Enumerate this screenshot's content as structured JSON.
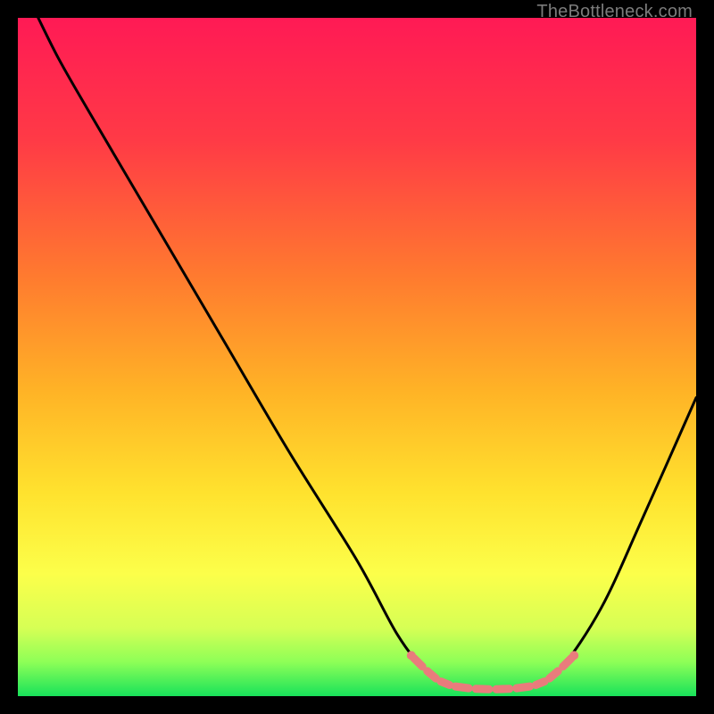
{
  "watermark": "TheBottleneck.com",
  "chart_data": {
    "type": "line",
    "title": "",
    "xlabel": "",
    "ylabel": "",
    "xlim": [
      0,
      100
    ],
    "ylim": [
      0,
      100
    ],
    "gradient_stops": [
      {
        "offset": 0,
        "color": "#ff1a55"
      },
      {
        "offset": 18,
        "color": "#ff3a46"
      },
      {
        "offset": 38,
        "color": "#ff7a2f"
      },
      {
        "offset": 55,
        "color": "#ffb326"
      },
      {
        "offset": 70,
        "color": "#ffe22e"
      },
      {
        "offset": 82,
        "color": "#fcff4a"
      },
      {
        "offset": 90,
        "color": "#d6ff55"
      },
      {
        "offset": 95,
        "color": "#8dff57"
      },
      {
        "offset": 100,
        "color": "#18e25a"
      }
    ],
    "series": [
      {
        "name": "bottleneck-curve",
        "color": "#000000",
        "points": [
          {
            "x": 3,
            "y": 100
          },
          {
            "x": 6,
            "y": 94
          },
          {
            "x": 10,
            "y": 87
          },
          {
            "x": 20,
            "y": 70
          },
          {
            "x": 30,
            "y": 53
          },
          {
            "x": 40,
            "y": 36
          },
          {
            "x": 50,
            "y": 20
          },
          {
            "x": 56,
            "y": 9
          },
          {
            "x": 60,
            "y": 4
          },
          {
            "x": 64,
            "y": 1.5
          },
          {
            "x": 70,
            "y": 1
          },
          {
            "x": 76,
            "y": 1.5
          },
          {
            "x": 80,
            "y": 4
          },
          {
            "x": 86,
            "y": 13
          },
          {
            "x": 92,
            "y": 26
          },
          {
            "x": 100,
            "y": 44
          }
        ]
      }
    ],
    "annotations": [
      {
        "name": "low-region-marker",
        "color": "#e97c7c",
        "points": [
          {
            "x": 58,
            "y": 6
          },
          {
            "x": 60,
            "y": 4
          },
          {
            "x": 62,
            "y": 2.3
          },
          {
            "x": 64,
            "y": 1.5
          },
          {
            "x": 67,
            "y": 1.1
          },
          {
            "x": 70,
            "y": 1
          },
          {
            "x": 73,
            "y": 1.1
          },
          {
            "x": 76,
            "y": 1.5
          },
          {
            "x": 78,
            "y": 2.3
          },
          {
            "x": 80,
            "y": 4
          },
          {
            "x": 82,
            "y": 6
          }
        ]
      }
    ]
  }
}
